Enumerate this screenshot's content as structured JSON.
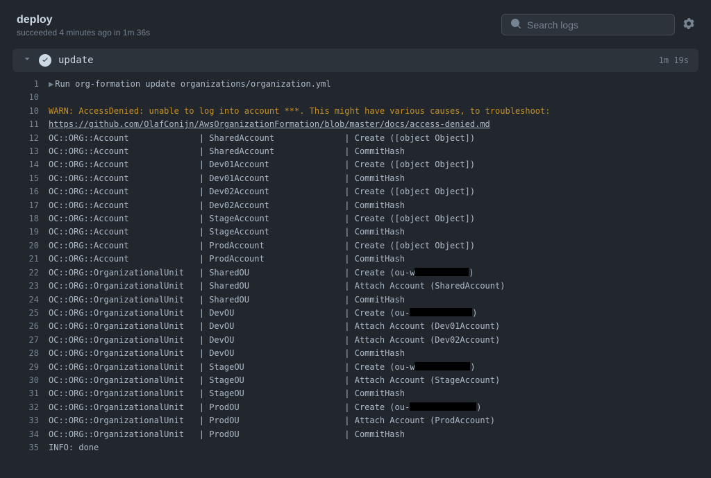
{
  "header": {
    "title": "deploy",
    "subtitle": "succeeded 4 minutes ago in 1m 36s",
    "search_placeholder": "Search logs"
  },
  "step": {
    "name": "update",
    "duration": "1m 19s"
  },
  "log": {
    "run_cmd": "Run org-formation update organizations/organization.yml",
    "warn": "WARN: AccessDenied: unable to log into account ***. This might have various causes, to troubleshoot:",
    "link": "https://github.com/OlafConijn/AwsOrganizationFormation/blob/master/docs/access-denied.md",
    "info_done": "INFO: done",
    "col": {
      "acct": "OC::ORG::Account           ",
      "ou": "OC::ORG::OrganizationalUnit"
    },
    "mid": {
      "shared_acct": "   | SharedAccount           ",
      "dev01_acct": "   | Dev01Account            ",
      "dev02_acct": "   | Dev02Account            ",
      "stage_acct": "   | StageAccount            ",
      "prod_acct": "   | ProdAccount             ",
      "shared_ou": "   | SharedOU                ",
      "dev_ou": "   | DevOU                   ",
      "stage_ou": "   | StageOU                 ",
      "prod_ou": "   | ProdOU                  "
    },
    "act": {
      "create_obj": "   | Create ([object Object])",
      "commit": "   | CommitHash",
      "create_ou_w": "   | Create (ou-w",
      "create_ou_": "   | Create (ou-",
      "close_paren": ")",
      "attach_shared": "   | Attach Account (SharedAccount)",
      "attach_dev01": "   | Attach Account (Dev01Account)",
      "attach_dev02": "   | Attach Account (Dev02Account)",
      "attach_stage": "   | Attach Account (StageAccount)",
      "attach_prod": "   | Attach Account (ProdAccount)"
    }
  }
}
